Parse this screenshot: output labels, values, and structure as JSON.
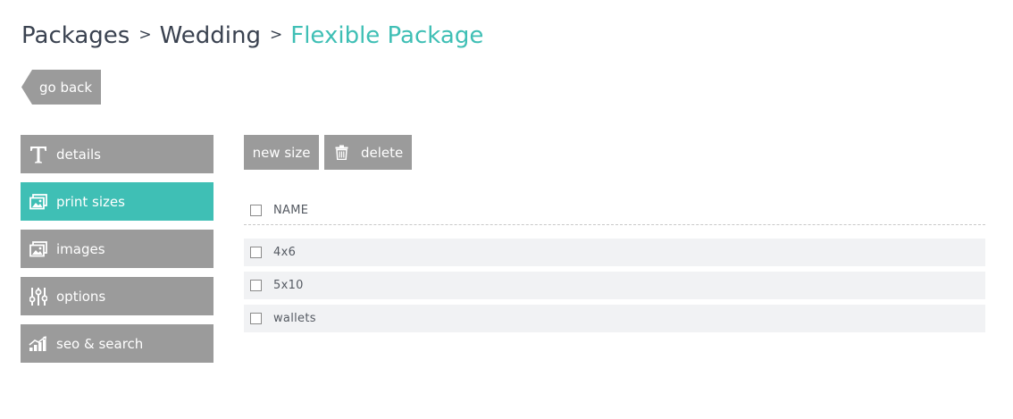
{
  "breadcrumb": {
    "items": [
      "Packages",
      "Wedding",
      "Flexible Package"
    ],
    "separator": ">"
  },
  "go_back": {
    "label": "go back"
  },
  "sidebar": {
    "items": [
      {
        "label": "details",
        "icon": "text-t-icon",
        "active": false
      },
      {
        "label": "print sizes",
        "icon": "image-icon",
        "active": true
      },
      {
        "label": "images",
        "icon": "image-icon",
        "active": false
      },
      {
        "label": "options",
        "icon": "sliders-icon",
        "active": false
      },
      {
        "label": "seo & search",
        "icon": "growth-chart-icon",
        "active": false
      }
    ]
  },
  "toolbar": {
    "new_label": "new size",
    "delete_label": "delete",
    "delete_icon": "trash-icon"
  },
  "table": {
    "columns": [
      "NAME"
    ],
    "rows": [
      {
        "name": "4x6"
      },
      {
        "name": "5x10"
      },
      {
        "name": "wallets"
      }
    ]
  },
  "colors": {
    "accent": "#3fbfb5",
    "button_gray": "#9b9b9b",
    "text_dark": "#3a4250",
    "row_bg": "#f1f2f4"
  }
}
